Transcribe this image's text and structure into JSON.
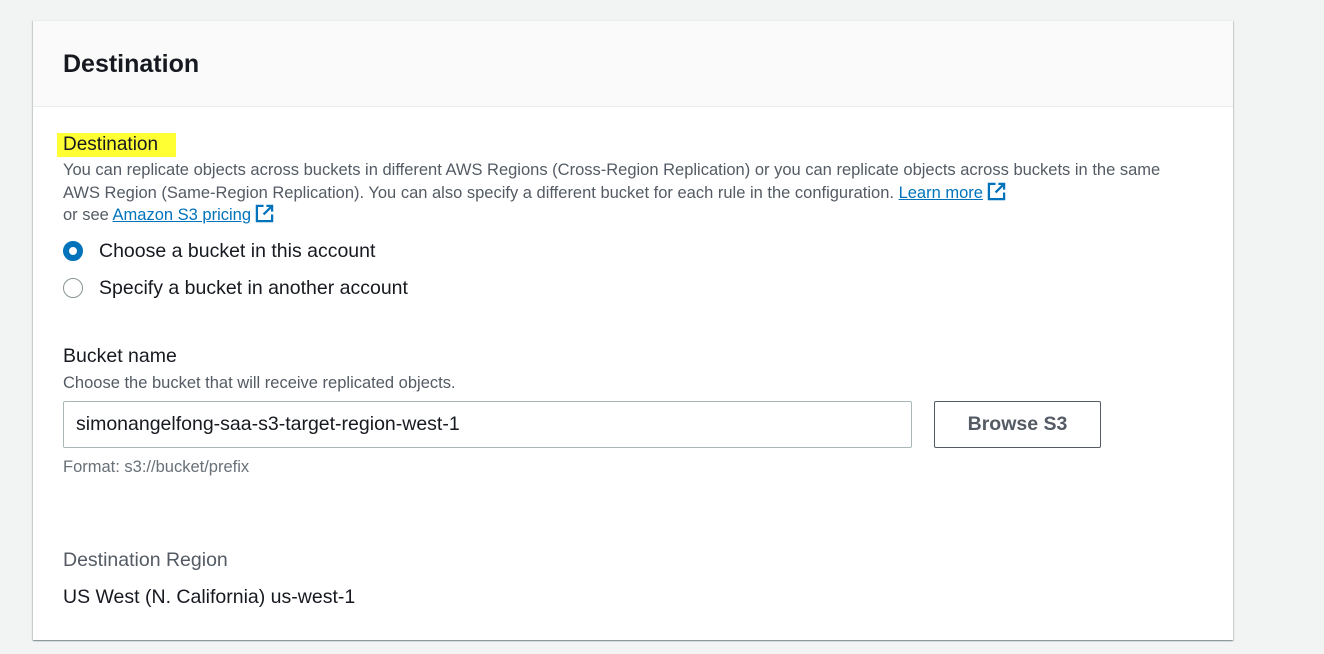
{
  "panel": {
    "title": "Destination"
  },
  "destination": {
    "label": "Destination",
    "description_text": "You can replicate objects across buckets in different AWS Regions (Cross-Region Replication) or you can replicate objects across buckets in the same AWS Region (Same-Region Replication). You can also specify a different bucket for each rule in the configuration.",
    "learn_more_link": "Learn more",
    "or_see_text": "or see",
    "pricing_link": "Amazon S3 pricing",
    "options": [
      {
        "label": "Choose a bucket in this account",
        "selected": true
      },
      {
        "label": "Specify a bucket in another account",
        "selected": false
      }
    ]
  },
  "bucket": {
    "label": "Bucket name",
    "description": "Choose the bucket that will receive replicated objects.",
    "value": "simonangelfong-saa-s3-target-region-west-1",
    "browse_label": "Browse S3",
    "format_hint": "Format: s3://bucket/prefix"
  },
  "region": {
    "label": "Destination Region",
    "value": "US West (N. California) us-west-1"
  },
  "colors": {
    "link": "#0073bb",
    "highlight": "#ffff33",
    "radio_selected": "#0073bb"
  },
  "icons": {
    "external_link": "external-link-icon"
  }
}
